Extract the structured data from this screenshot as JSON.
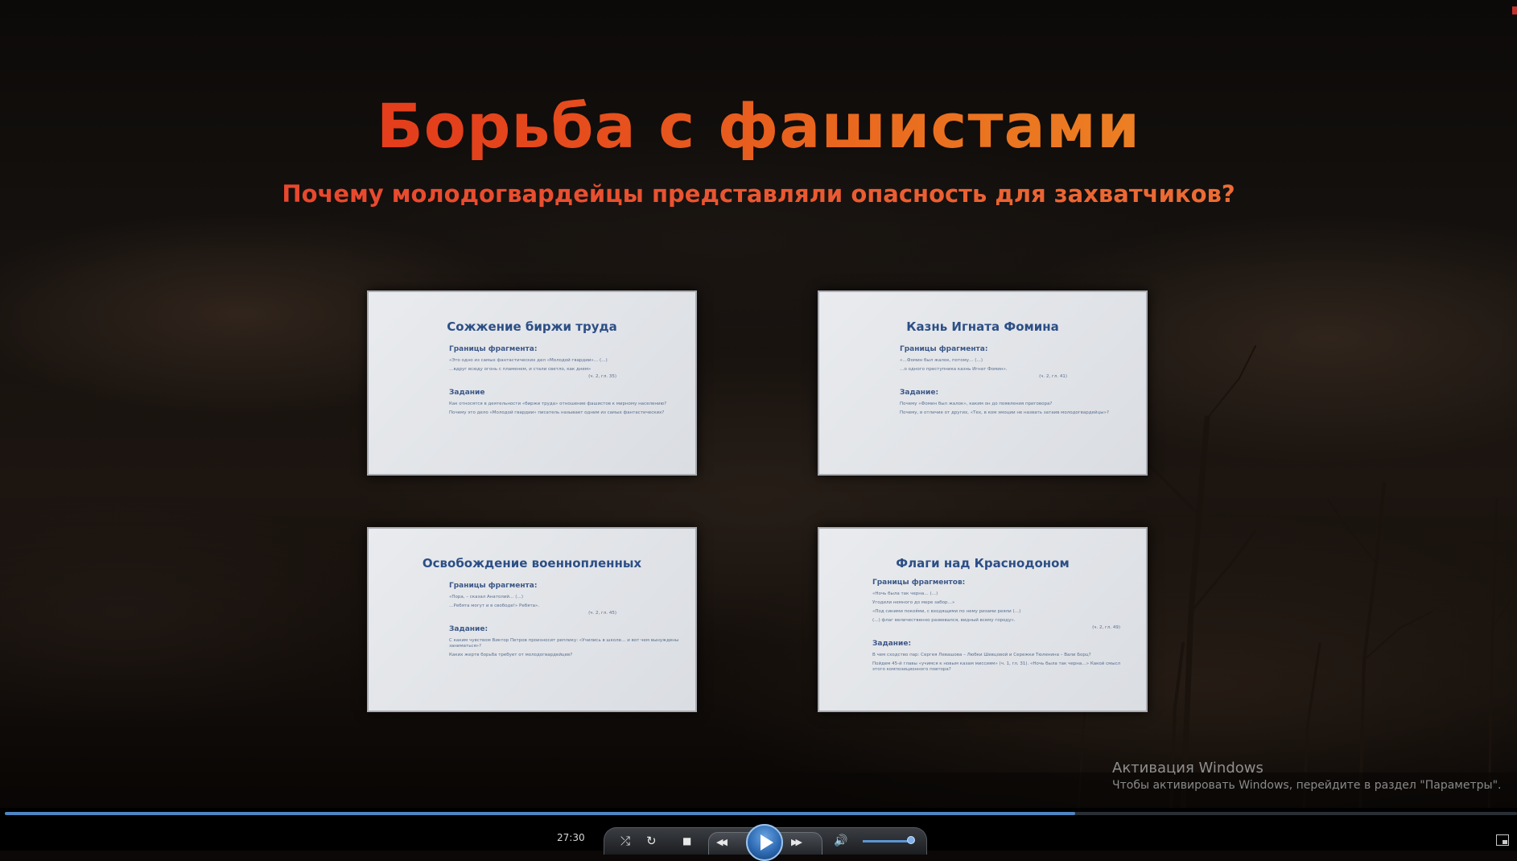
{
  "video": {
    "title": "Борьба с фашистами",
    "subtitle": "Почему молодогвардейцы представляли опасность для захватчиков?",
    "slides": [
      {
        "title": "Сожжение биржи труда",
        "bounds_label": "Границы фрагмента:",
        "bounds_text": [
          "«Это одно из самых фантастических дел «Молодой гвардии»… (…)",
          "…вдруг всюду огонь с пламенем, и стали светло, как днем»"
        ],
        "bounds_ref": "(ч. 2, гл. 35)",
        "task_label": "Задание",
        "task_text": [
          "Как относятся в деятельности «биржи труда» отношение фашистов к мирному населению?",
          "Почему это дело «Молодой гвардии» писатель называет одним из самых фантастических?"
        ]
      },
      {
        "title": "Казнь Игната Фомина",
        "bounds_label": "Границы фрагмента:",
        "bounds_text": [
          "«…Фомин был жалок, потому… (…)",
          "…о одного преступника казнь Игнат Фомин»."
        ],
        "bounds_ref": "(ч. 2, гл. 41)",
        "task_label": "Задание:",
        "task_text": [
          "Почему «Фомин был жалок», каким он до появления приговора?",
          "Почему, в отличие от других, «Тех, в ком эмоции не назвать затаив молодогвардейцы»?"
        ]
      },
      {
        "title": "Освобождение военнопленных",
        "bounds_label": "Границы фрагмента:",
        "bounds_text": [
          "«Пора, – сказал Анатолий… (…)",
          "…Ребята могут и в свободе!» Ребята»."
        ],
        "bounds_ref": "(ч. 2, гл. 45)",
        "task_label": "Задание:",
        "task_text": [
          "С каким чувством Виктор Петров произносит реплику: «Учились в школе… и вот чем вынуждены заниматься»?",
          "Каких жертв борьба требует от молодогвардейцев?"
        ]
      },
      {
        "title": "Флаги над Краснодоном",
        "bounds_label": "Границы фрагментов:",
        "bounds_text": [
          "«Ночь была так черна… (…)",
          "Угодили немного до мере забор…»",
          "«Под синими покоя́ми, с входящими по нему ризами реяли (…)",
          "(…) флаг величественно развевался, видный всему городу»."
        ],
        "bounds_ref": "(ч. 2, гл. 49)",
        "task_label": "Задание:",
        "task_text": [
          "В чем сходство пар: Сергея Левашова – Любки Шевцовой и Сережки Тюленина – Вали Борц?",
          "Пойдем 45-й главы «учимся к новым казам миссиям» (ч. 1, гл. 31). «Ночь была так черна…» Какой смысл этого композиционного повтора?"
        ]
      }
    ]
  },
  "watermark": {
    "line1": "Активация Windows",
    "line2": "Чтобы активировать Windows, перейдите в раздел \"Параметры\"."
  },
  "player": {
    "time": "27:30",
    "progress": 0.708,
    "volume": 0.86,
    "buttons": {
      "shuffle": "⤮",
      "repeat": "↻",
      "stop": "■",
      "prev": "◀◀",
      "next": "▶▶",
      "volume": "🔊"
    }
  },
  "colors": {
    "title_start": "#e5341b",
    "title_end": "#f09a2a",
    "slide_title": "#2c4f86",
    "seek_fill": "#4f86c2"
  }
}
